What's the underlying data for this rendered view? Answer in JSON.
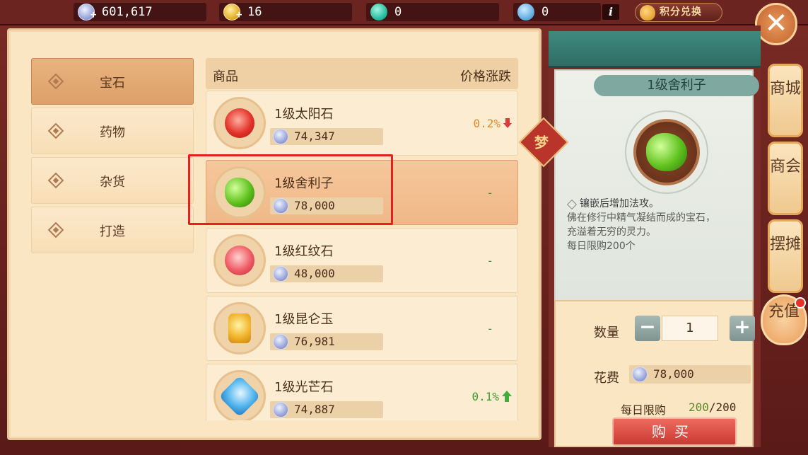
{
  "currencies": [
    {
      "name": "silver",
      "value": "601,617",
      "icon": "silver-coin-icon"
    },
    {
      "name": "gold",
      "value": "16",
      "icon": "gold-ingot-icon"
    },
    {
      "name": "jade",
      "value": "0",
      "icon": "jade-token-icon"
    },
    {
      "name": "tickets",
      "value": "0",
      "icon": "ticket-icon"
    }
  ],
  "header": {
    "info_label": "i",
    "points_exchange_label": "积分兑换",
    "close_label": "✕"
  },
  "categories": [
    {
      "label": "宝石",
      "active": true
    },
    {
      "label": "药物",
      "active": false
    },
    {
      "label": "杂货",
      "active": false
    },
    {
      "label": "打造",
      "active": false
    }
  ],
  "list": {
    "header_item": "商品",
    "header_change": "价格涨跌",
    "items": [
      {
        "name": "1级太阳石",
        "price": "74,347",
        "change": "0.2%",
        "trend": "down",
        "icon": "sun-stone-icon"
      },
      {
        "name": "1级舍利子",
        "price": "78,000",
        "change": "-",
        "trend": "flat",
        "icon": "sarira-icon",
        "selected": true
      },
      {
        "name": "1级红纹石",
        "price": "48,000",
        "change": "-",
        "trend": "flat",
        "icon": "red-stone-icon"
      },
      {
        "name": "1级昆仑玉",
        "price": "76,981",
        "change": "-",
        "trend": "flat",
        "icon": "kunlun-jade-icon"
      },
      {
        "name": "1级光芒石",
        "price": "74,887",
        "change": "0.1%",
        "trend": "up",
        "icon": "light-stone-icon"
      }
    ]
  },
  "detail": {
    "title": "1级舍利子",
    "knot_label": "梦",
    "desc_line1": "镶嵌后增加法攻。",
    "desc_line2": "佛在修行中精气凝结而成的宝石，",
    "desc_line3": "充溢着无穷的灵力。",
    "desc_line4": "每日限购200个"
  },
  "buy": {
    "quantity_label": "数量",
    "minus_label": "−",
    "quantity_value": "1",
    "plus_label": "+",
    "cost_label": "花费",
    "cost_value": "78,000",
    "limit_label": "每日限购",
    "limit_used": "200",
    "limit_total": "/200",
    "buy_label": "购买"
  },
  "side_tabs": {
    "mall": "商城",
    "guild": "商会",
    "stall": "摆摊",
    "recharge": "充值"
  }
}
